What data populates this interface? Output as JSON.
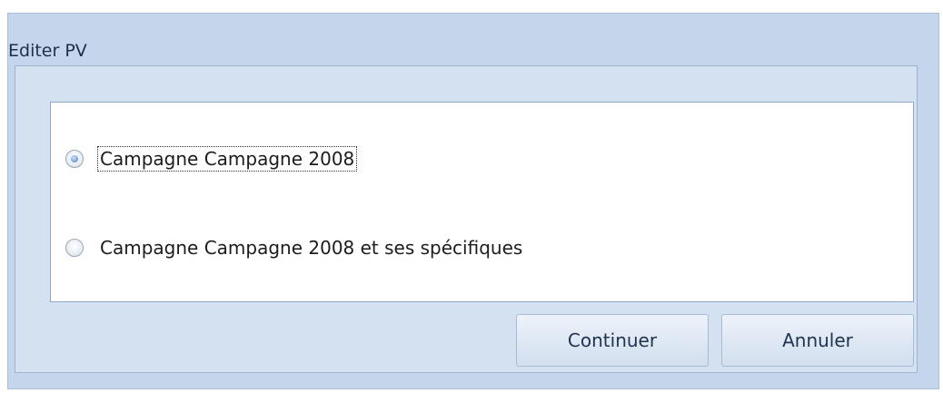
{
  "window": {
    "title": "Editer PV"
  },
  "options": [
    {
      "label": "Campagne Campagne 2008",
      "checked": true
    },
    {
      "label": "Campagne Campagne 2008 et ses spécifiques",
      "checked": false
    }
  ],
  "buttons": {
    "continue_label": "Continuer",
    "cancel_label": "Annuler"
  },
  "colors": {
    "window_background": "#c5d6ec",
    "panel_background": "#ffffff",
    "button_text": "#20344f"
  }
}
